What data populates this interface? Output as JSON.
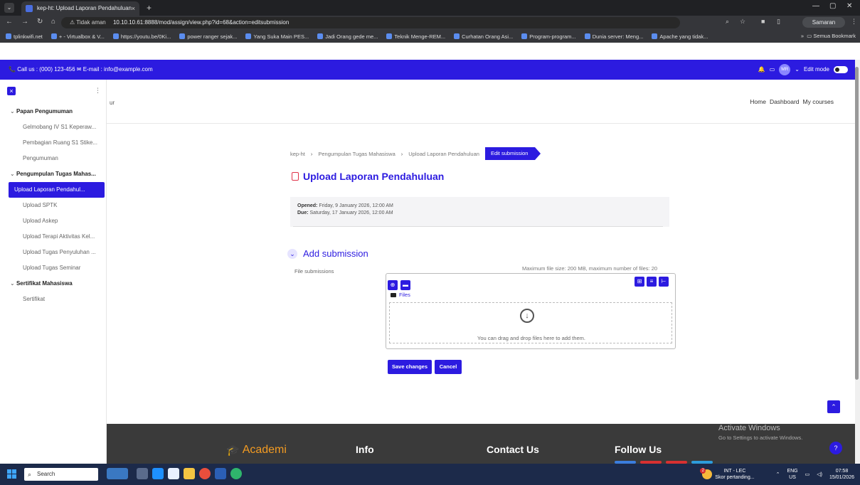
{
  "browser": {
    "tab_title": "kep-ht: Upload Laporan Pendahuluan",
    "tab_close": "×",
    "new_tab": "+",
    "security": "Tidak aman",
    "url": "10.10.10.61:8888/mod/assign/view.php?id=68&action=editsubmission",
    "profile": "Samaran",
    "bookmarks": [
      "tplinkwifi.net",
      "+ - Virtualbox & V...",
      "https://youtu.be/0Ki...",
      "power ranger sejak...",
      "Yang Suka Main PES...",
      "Jadi Orang gede me...",
      "Teknik Menge-REM...",
      "Curhatan Orang Asi...",
      "Program-program...",
      "Dunia server: Meng...",
      "Apache yang tidak..."
    ],
    "all_bookmarks": "Semua Bookmark"
  },
  "infobar": {
    "contact": "Call us : (000) 123-456  ✉ E-mail : info@example.com",
    "avatar": "MR",
    "edit_mode": "Edit mode"
  },
  "sidebar": {
    "sections": [
      {
        "title": "Papan Pengumuman",
        "items": [
          "Gelmobang IV S1 Keperaw...",
          "Pembagian Ruang S1 Stike...",
          "Pengumuman"
        ]
      },
      {
        "title": "Pengumpulan Tugas Mahas...",
        "items": [
          "Upload Laporan Pendahul...",
          "Upload SPTK",
          "Upload Askep",
          "Upload Terapi Aktivitas Kel...",
          "Upload Tugas Penyuluhan ...",
          "Upload Tugas Seminar"
        ]
      },
      {
        "title": "Sertifikat Mahasiswa",
        "items": [
          "Sertifikat"
        ]
      }
    ]
  },
  "header": {
    "site_tail": "ur",
    "nav": [
      "Home",
      "Dashboard",
      "My courses"
    ]
  },
  "breadcrumb": {
    "items": [
      "kep-ht",
      "Pengumpulan Tugas Mahasiswa",
      "Upload Laporan Pendahuluan"
    ],
    "active": "Edit submission"
  },
  "page": {
    "title": "Upload Laporan Pendahuluan",
    "opened_label": "Opened:",
    "opened_value": "Friday, 9 January 2026, 12:00 AM",
    "due_label": "Due:",
    "due_value": "Saturday, 17 January 2026, 12:00 AM",
    "add_submission": "Add submission",
    "file_submissions": "File submissions",
    "max_size": "Maximum file size: 200 MB, maximum number of files: 20",
    "files_path": "Files",
    "dropzone_text": "You can drag and drop files here to add them.",
    "save_label": "Save changes",
    "cancel_label": "Cancel"
  },
  "footer": {
    "logo": "Academi",
    "info": "Info",
    "contact": "Contact Us",
    "follow": "Follow Us",
    "activate_title": "Activate Windows",
    "activate_sub": "Go to Settings to activate Windows."
  },
  "taskbar": {
    "search": "Search",
    "weather_badge": "2",
    "weather_title": "INT - LEC",
    "weather_sub": "Skor pertanding...",
    "lang_top": "ENG",
    "lang_bottom": "US",
    "time": "07:58",
    "date": "15/01/2026"
  },
  "colors": {
    "brand": "#2c1be0",
    "footer_bg": "#3a3a3a",
    "logo_orange": "#f39b22"
  }
}
